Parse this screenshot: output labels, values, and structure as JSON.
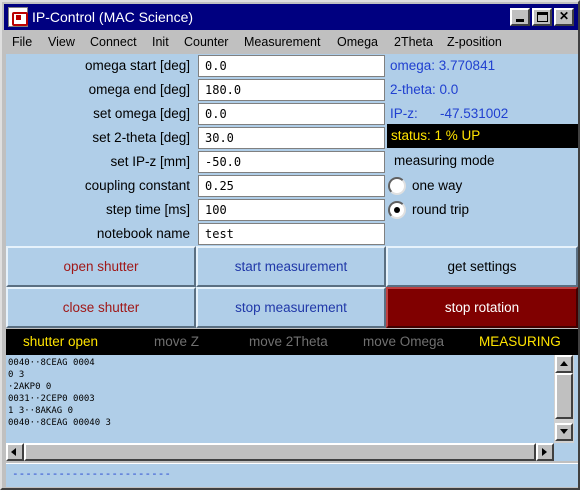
{
  "window": {
    "title": "IP-Control (MAC Science)"
  },
  "menu": [
    "File",
    "View",
    "Connect",
    "Init",
    "Counter",
    "Measurement",
    "Omega",
    "2Theta",
    "Z-position"
  ],
  "form": {
    "omega_start": {
      "label": "omega start  [deg]",
      "value": "0.0"
    },
    "omega_end": {
      "label": "omega end  [deg]",
      "value": "180.0"
    },
    "set_omega": {
      "label": "set omega  [deg]",
      "value": "0.0"
    },
    "set_2theta": {
      "label": "set 2-theta  [deg]",
      "value": "30.0"
    },
    "set_ipz": {
      "label": "set IP-z  [mm]",
      "value": "-50.0"
    },
    "coupling": {
      "label": "coupling constant",
      "value": "0.25"
    },
    "step_time": {
      "label": "step time  [ms]",
      "value": "100"
    },
    "notebook": {
      "label": "notebook name",
      "value": "test"
    }
  },
  "readouts": {
    "omega": "omega: 3.770841",
    "two_theta": "2-theta: 0.0",
    "ipz_label": "IP-z:",
    "ipz_value": "-47.531002",
    "status": "status: 1 %   UP"
  },
  "mode": {
    "label": "measuring mode",
    "one_way": "one way",
    "round_trip": "round trip",
    "selected": "round trip"
  },
  "buttons": {
    "open_shutter": "open  shutter",
    "start_measurement": "start measurement",
    "get_settings": "get settings",
    "close_shutter": "close shutter",
    "stop_measurement": "stop  measurement",
    "stop_rotation": "stop rotation"
  },
  "indicators": {
    "shutter_open": "shutter open",
    "move_z": "move Z",
    "move_2theta": "move 2Theta",
    "move_omega": "move Omega",
    "measuring": "MEASURING"
  },
  "log": "0040··8CEAG 0004\n0 3\n·2AKP0 0\n0031··2CEP0 0003\n1 3··8AKAG 0\n0040··8CEAG 00040 3",
  "footer": "------------------------",
  "colors": {
    "panel": "#b0cee8",
    "titlebar": "#000080",
    "accent_text": "#2040d0",
    "status_text": "#ffe400",
    "stop_button": "#800000"
  }
}
